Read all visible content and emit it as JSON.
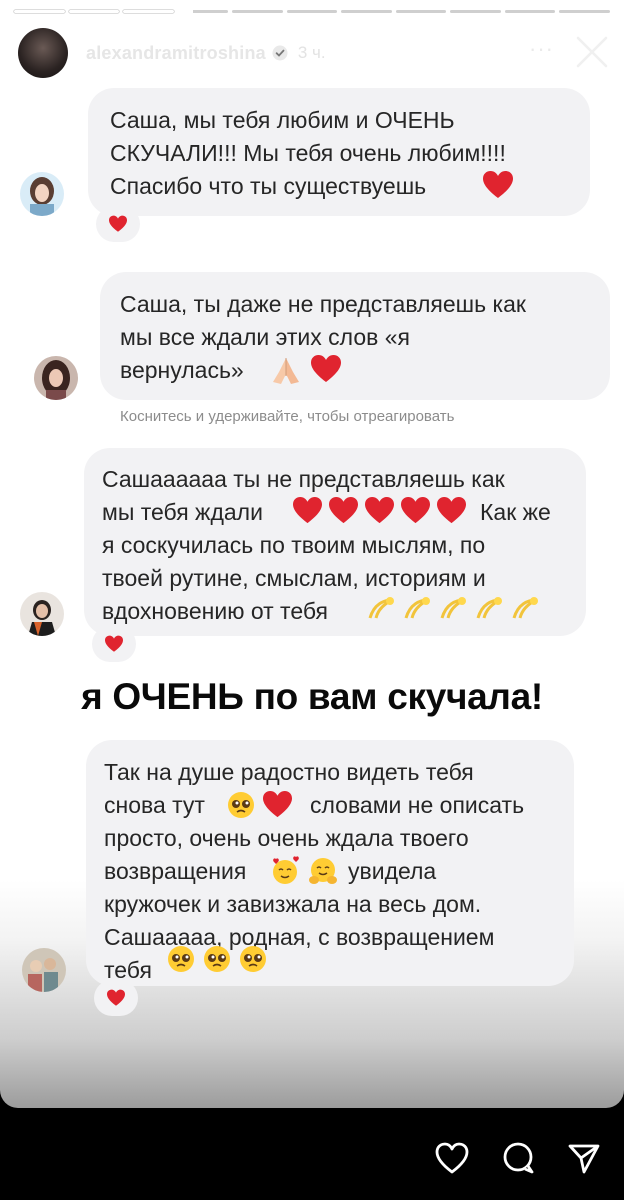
{
  "story": {
    "username": "alexandramitroshina",
    "time_ago": "3 ч.",
    "more_label": "···",
    "progress_bars": 11
  },
  "comments": [
    {
      "lines": "Саша, мы тебя любим и ОЧЕНЬ\nСКУЧАЛИ!!! Мы тебя очень любим!!!!\nСпасибо что ты существуешь"
    },
    {
      "lines": "Саша, ты даже не представляешь как\nмы все ждали этих слов «я\nвернулась»"
    },
    {
      "lines_a": "Сашаааааа ты не представляешь как\nмы тебя ждали",
      "lines_b": "Как же",
      "lines_c": "я соскучилась по твоим мыслям, по\nтвоей рутине, смыслам, историям и\nвдохновению от тебя"
    },
    {
      "l1": "Так на душе радостно видеть тебя",
      "l2a": "снова тут",
      "l2b": "словами не описать",
      "l3": "просто, очень очень ждала твоего",
      "l4a": "возвращения",
      "l4b": "увидела",
      "l5": "кружочек и завизжала на весь дом.",
      "l6": "Сашааааа, родная, с возвращением",
      "l7": "тебя"
    }
  ],
  "hint_text": "Коснитесь и удерживайте, чтобы отреагировать",
  "headline": "я ОЧЕНЬ по вам скучала!",
  "colors": {
    "heart": "#e0242f",
    "bubble": "#f2f2f4",
    "text": "#262626"
  },
  "icons": [
    "heart-icon",
    "comment-icon",
    "share-icon",
    "close-icon",
    "verified-icon"
  ]
}
